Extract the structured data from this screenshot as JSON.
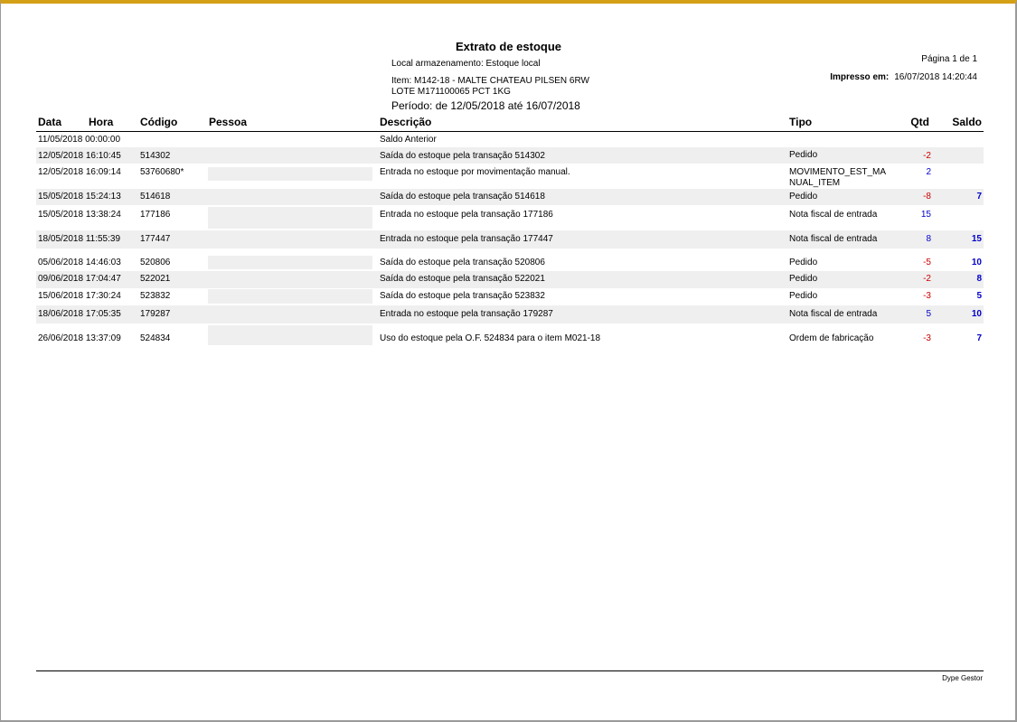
{
  "report": {
    "title": "Extrato de estoque",
    "local": "Local armazenamento: Estoque local",
    "item_line1": "Item: M142-18 - MALTE CHATEAU PILSEN 6RW",
    "item_line2": "LOTE M171100065 PCT 1KG",
    "periodo": "Período:  de 12/05/2018 até 16/07/2018",
    "pagina": "Página 1 de 1",
    "impresso_label": "Impresso em:",
    "impresso_value": "16/07/2018 14:20:44"
  },
  "columns": {
    "data": "Data",
    "hora": "Hora",
    "codigo": "Código",
    "pessoa": "Pessoa",
    "descricao": "Descrição",
    "tipo": "Tipo",
    "qtd": "Qtd",
    "saldo": "Saldo"
  },
  "rows": [
    {
      "datetime": "11/05/2018 00:00:00",
      "codigo": "",
      "descricao": "Saldo Anterior",
      "tipo": "",
      "qtd": "",
      "saldo": ""
    },
    {
      "datetime": "12/05/2018 16:10:45",
      "codigo": "514302",
      "descricao": "Saída do estoque pela transação 514302",
      "tipo": "Pedido",
      "qtd": "-2",
      "saldo": ""
    },
    {
      "datetime": "12/05/2018 16:09:14",
      "codigo": "53760680*",
      "descricao": "Entrada no estoque por movimentação manual.",
      "tipo": "MOVIMENTO_EST_MA",
      "tipo2": "NUAL_ITEM",
      "qtd": "2",
      "saldo": ""
    },
    {
      "datetime": "15/05/2018 15:24:13",
      "codigo": "514618",
      "descricao": "Saída do estoque pela transação 514618",
      "tipo": "Pedido",
      "qtd": "-8",
      "saldo": "7"
    },
    {
      "datetime": "15/05/2018 13:38:24",
      "codigo": "177186",
      "descricao": "Entrada no estoque pela transação 177186",
      "tipo": "Nota fiscal de entrada",
      "qtd": "15",
      "saldo": ""
    },
    {
      "datetime": "18/05/2018 11:55:39",
      "codigo": "177447",
      "descricao": "Entrada no estoque pela transação 177447",
      "tipo": "Nota fiscal de entrada",
      "qtd": "8",
      "saldo": "15"
    },
    {
      "datetime": "05/06/2018 14:46:03",
      "codigo": "520806",
      "descricao": "Saída do estoque pela transação 520806",
      "tipo": "Pedido",
      "qtd": "-5",
      "saldo": "10"
    },
    {
      "datetime": "09/06/2018 17:04:47",
      "codigo": "522021",
      "descricao": "Saída do estoque pela transação 522021",
      "tipo": "Pedido",
      "qtd": "-2",
      "saldo": "8"
    },
    {
      "datetime": "15/06/2018 17:30:24",
      "codigo": "523832",
      "descricao": "Saída do estoque pela transação 523832",
      "tipo": "Pedido",
      "qtd": "-3",
      "saldo": "5"
    },
    {
      "datetime": "18/06/2018 17:05:35",
      "codigo": "179287",
      "descricao": "Entrada no estoque pela transação 179287",
      "tipo": "Nota fiscal de entrada",
      "qtd": "5",
      "saldo": "10"
    },
    {
      "datetime": "26/06/2018 13:37:09",
      "codigo": "524834",
      "descricao": "Uso do estoque pela O.F. 524834 para o item M021-18",
      "tipo": "Ordem de fabricação",
      "qtd": "-3",
      "saldo": "7"
    }
  ],
  "footer": {
    "brand": "Dype Gestor"
  },
  "colors": {
    "negative": "#cc0000",
    "positive": "#0000cc",
    "frame_top": "#d4a017"
  }
}
